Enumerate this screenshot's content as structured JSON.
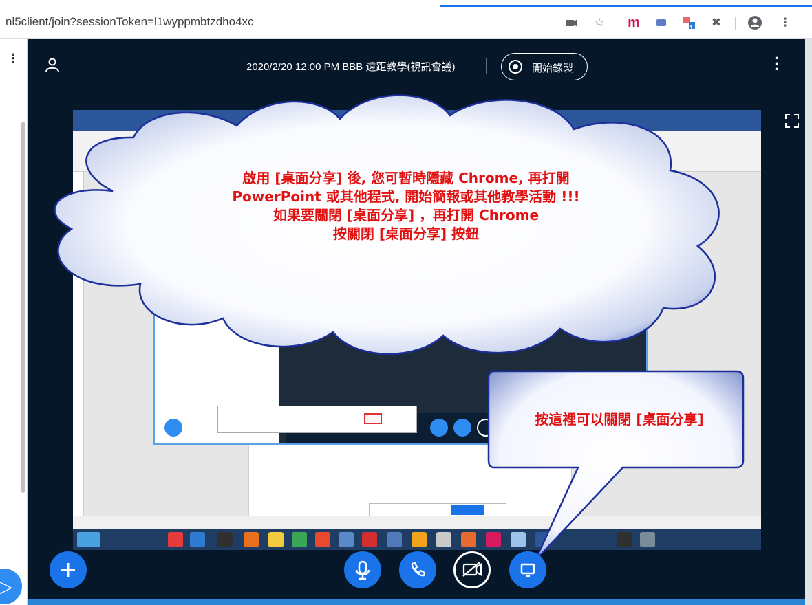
{
  "browser": {
    "url": "nl5client/join?sessionToken=l1wyppmbtzdho4xc",
    "extension_m_label": "m",
    "extension_badge": "1"
  },
  "header": {
    "meeting_title": "2020/2/20 12:00 PM BBB 遠距教學(視訊會議)",
    "record_button_label": "開始錄製"
  },
  "cloud_callout": {
    "lines": [
      "啟用 [桌面分享] 後, 您可暫時隱藏 Chrome, 再打開",
      "PowerPoint 或其他程式, 開始簡報或其他教學活動 !!!",
      "如果要關閉  [桌面分享] ，再打開 Chrome",
      "按關閉 [桌面分享] 按鈕"
    ]
  },
  "box_callout": {
    "text": "按這裡可以關閉 [桌面分享]"
  },
  "controls": {
    "icons": [
      "plus-icon",
      "microphone-icon",
      "phone-icon",
      "camera-off-icon",
      "screen-share-icon"
    ]
  },
  "colors": {
    "app_background": "#06172a",
    "accent": "#1a73e8",
    "callout_text": "#e21010",
    "callout_border": "#1c2f9a"
  }
}
